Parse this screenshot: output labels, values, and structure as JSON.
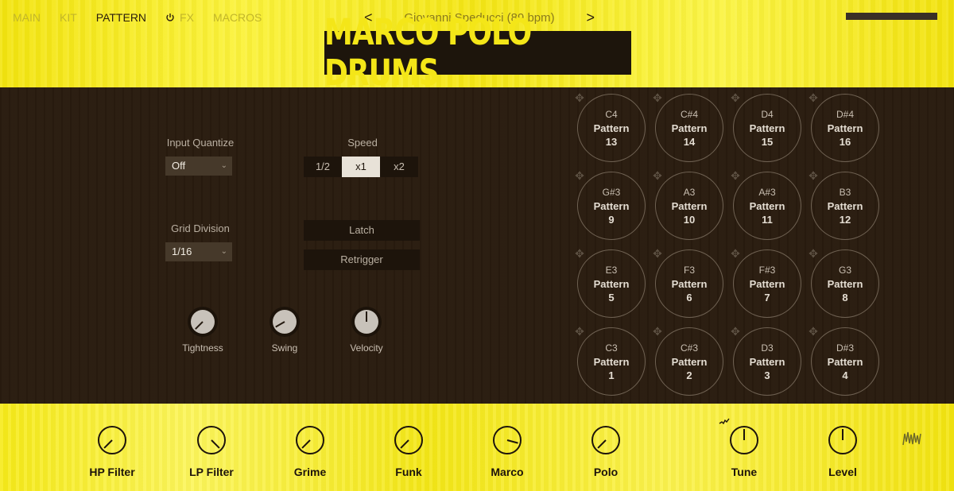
{
  "tabs": [
    {
      "label": "MAIN",
      "active": false
    },
    {
      "label": "KIT",
      "active": false
    },
    {
      "label": "PATTERN",
      "active": true
    },
    {
      "label": "FX",
      "active": false,
      "icon": "power-icon"
    },
    {
      "label": "MACROS",
      "active": false
    }
  ],
  "header": {
    "preset": "Giovanni Speducci (89 bpm)",
    "prev_arrow": "<",
    "next_arrow": ">",
    "logo": "MARCO POLO DRUMS"
  },
  "pattern": {
    "input_quantize_label": "Input Quantize",
    "input_quantize_value": "Off",
    "speed_label": "Speed",
    "speed_options": [
      "1/2",
      "x1",
      "x2"
    ],
    "speed_selected": "x1",
    "grid_division_label": "Grid Division",
    "grid_division_value": "1/16",
    "latch_label": "Latch",
    "retrigger_label": "Retrigger",
    "knobs": [
      {
        "label": "Tightness",
        "angle": -135
      },
      {
        "label": "Swing",
        "angle": -120
      },
      {
        "label": "Velocity",
        "angle": 0
      }
    ]
  },
  "pads": [
    {
      "note": "C4",
      "label": "Pattern",
      "number": "13"
    },
    {
      "note": "C#4",
      "label": "Pattern",
      "number": "14"
    },
    {
      "note": "D4",
      "label": "Pattern",
      "number": "15"
    },
    {
      "note": "D#4",
      "label": "Pattern",
      "number": "16"
    },
    {
      "note": "G#3",
      "label": "Pattern",
      "number": "9"
    },
    {
      "note": "A3",
      "label": "Pattern",
      "number": "10"
    },
    {
      "note": "A#3",
      "label": "Pattern",
      "number": "11"
    },
    {
      "note": "B3",
      "label": "Pattern",
      "number": "12"
    },
    {
      "note": "E3",
      "label": "Pattern",
      "number": "5"
    },
    {
      "note": "F3",
      "label": "Pattern",
      "number": "6"
    },
    {
      "note": "F#3",
      "label": "Pattern",
      "number": "7"
    },
    {
      "note": "G3",
      "label": "Pattern",
      "number": "8"
    },
    {
      "note": "C3",
      "label": "Pattern",
      "number": "1"
    },
    {
      "note": "C#3",
      "label": "Pattern",
      "number": "2"
    },
    {
      "note": "D3",
      "label": "Pattern",
      "number": "3"
    },
    {
      "note": "D#3",
      "label": "Pattern",
      "number": "4"
    }
  ],
  "macros": [
    {
      "label": "HP Filter",
      "angle": -135
    },
    {
      "label": "LP Filter",
      "angle": 135
    },
    {
      "label": "Grime",
      "angle": -135
    },
    {
      "label": "Funk",
      "angle": -135
    },
    {
      "label": "Marco",
      "angle": 105
    },
    {
      "label": "Polo",
      "angle": -135
    },
    {
      "label": "Tune",
      "angle": 0
    },
    {
      "label": "Level",
      "angle": 0
    }
  ],
  "colors": {
    "accent_yellow": "#f6ea18",
    "panel_brown": "#2a1c0f",
    "dark": "#1d140b"
  }
}
